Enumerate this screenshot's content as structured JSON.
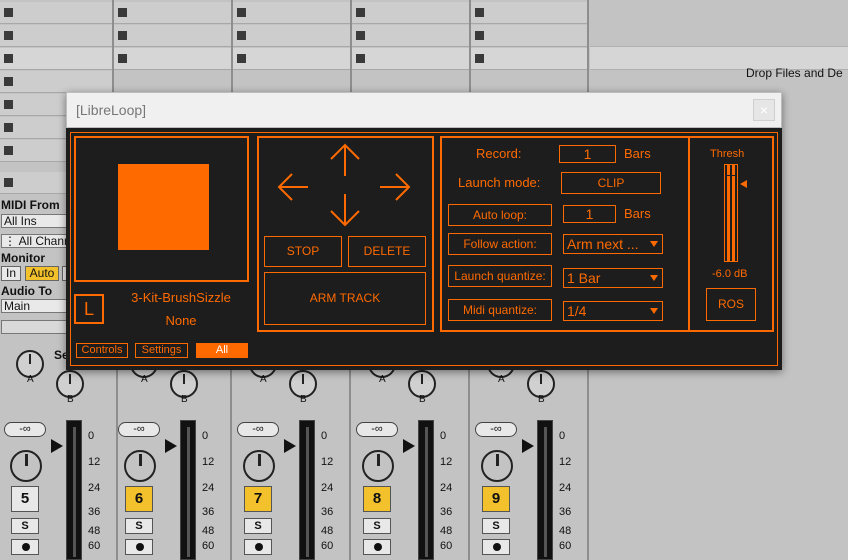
{
  "session": {
    "drop_text": "Drop Files and De",
    "io": {
      "midi_from_label": "MIDI From",
      "midi_from_value": "All Ins",
      "channel_value": "All Chann",
      "monitor_label": "Monitor",
      "monitor_in": "In",
      "monitor_auto": "Auto",
      "audio_to_label": "Audio To",
      "audio_to_value": "Main",
      "sends_label": "Se"
    },
    "knob_labels": {
      "a": "A",
      "b": "B"
    },
    "volume_text": "-∞",
    "solo_label": "S",
    "meter_scale": [
      "0",
      "12",
      "24",
      "36",
      "48",
      "60"
    ],
    "tracks": [
      "5",
      "6",
      "7",
      "8",
      "9"
    ]
  },
  "plugin": {
    "title": "[LibreLoop]",
    "close_symbol": "×",
    "accent_color": "#ff6a00",
    "bg_color": "#1d1d1d",
    "logo_letter": "L",
    "clip_name": "3-Kit-BrushSizzle",
    "clip_sub": "None",
    "tabs": [
      "Controls",
      "Settings",
      "All"
    ],
    "nav_icons": [
      "arrow-up",
      "arrow-left",
      "arrow-right",
      "arrow-down"
    ],
    "stop_label": "STOP",
    "delete_label": "DELETE",
    "arm_label": "ARM TRACK",
    "record_label": "Record:",
    "record_value": "1",
    "bars_label": "Bars",
    "launch_mode_label": "Launch mode:",
    "launch_mode_value": "CLIP",
    "auto_loop_label": "Auto loop:",
    "auto_loop_value": "1",
    "follow_action_label": "Follow action:",
    "follow_action_value": "Arm next ...",
    "launch_quantize_label": "Launch quantize:",
    "launch_quantize_value": "1 Bar",
    "midi_quantize_label": "Midi quantize:",
    "midi_quantize_value": "1/4",
    "thresh_label": "Thresh",
    "thresh_value": "-6.0 dB",
    "ros_label": "ROS"
  }
}
